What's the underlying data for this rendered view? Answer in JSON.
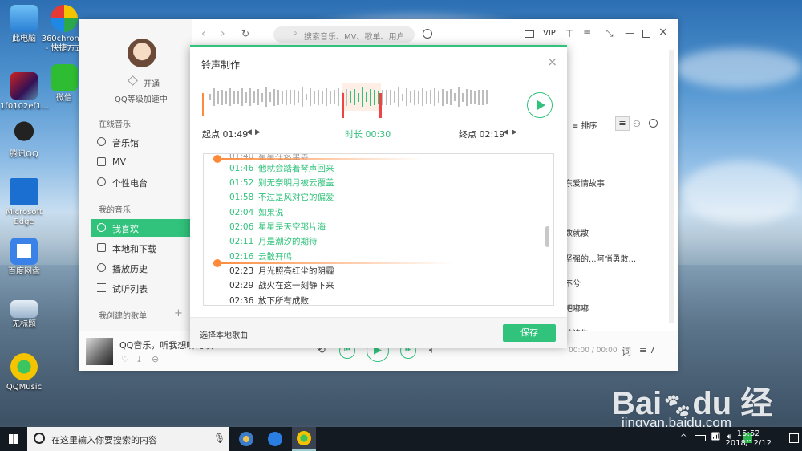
{
  "desktop": {
    "icons": [
      {
        "label": "此电脑"
      },
      {
        "label": "360chrome - 快捷方式"
      },
      {
        "label": "1f0102ef1..."
      },
      {
        "label": "微信"
      },
      {
        "label": "腾讯QQ"
      },
      {
        "label": "Microsoft Edge"
      },
      {
        "label": "百度网盘"
      },
      {
        "label": "无标题"
      },
      {
        "label": "QQMusic"
      }
    ]
  },
  "app": {
    "search_placeholder": "搜索音乐、MV、歌单、用户",
    "vip_label": "VIP",
    "user": {
      "open_label": "开通",
      "level_text": "QQ等级加速中"
    },
    "sidebar": {
      "online_section": "在线音乐",
      "online_items": [
        "音乐馆",
        "MV",
        "个性电台"
      ],
      "my_section": "我的音乐",
      "my_items": [
        "我喜欢",
        "本地和下载",
        "播放历史",
        "试听列表"
      ],
      "created_section": "我创建的歌单"
    },
    "sort_label": "排序",
    "list_rows": [
      "东爱情故事",
      "数就散",
      "坚强的...阿悄勇敢...",
      "不兮",
      "吧嘟嘟",
      "神诗告"
    ],
    "playbar": {
      "song_text": "QQ音乐，听我想听的歌",
      "time_text": "00:00 / 00:00",
      "lyric_label": "词",
      "count": "7"
    }
  },
  "dialog": {
    "title": "铃声制作",
    "start_label": "起点 01:49",
    "duration_label": "时长 00:30",
    "end_label": "终点 02:19",
    "lyrics": [
      {
        "time": "01:40",
        "text": "星星在这里等",
        "state": "partial"
      },
      {
        "time": "01:46",
        "text": "他就会踏着琴声回来",
        "state": "selected"
      },
      {
        "time": "01:52",
        "text": "别无奈明月被云覆盖",
        "state": "selected"
      },
      {
        "time": "01:58",
        "text": "不过是风对它的偏爱",
        "state": "selected"
      },
      {
        "time": "02:04",
        "text": "如果说",
        "state": "selected"
      },
      {
        "time": "02:06",
        "text": "星星是天空那片海",
        "state": "selected"
      },
      {
        "time": "02:11",
        "text": "月是潮汐的期待",
        "state": "selected"
      },
      {
        "time": "02:16",
        "text": "云散开鸣",
        "state": "selected"
      },
      {
        "time": "02:23",
        "text": "月光照亮红尘的阴霾",
        "state": "normal"
      },
      {
        "time": "02:29",
        "text": "战火在这一刻静下来",
        "state": "normal"
      },
      {
        "time": "02:36",
        "text": "放下所有成败",
        "state": "normal"
      }
    ],
    "local_song_label": "选择本地歌曲",
    "save_label": "保存"
  },
  "taskbar": {
    "search_placeholder": "在这里输入你要搜索的内容",
    "time": "15:52",
    "date": "2018/12/12"
  },
  "watermark": {
    "logo": "Bai百du经验",
    "url": "jingyan.baidu.com"
  }
}
